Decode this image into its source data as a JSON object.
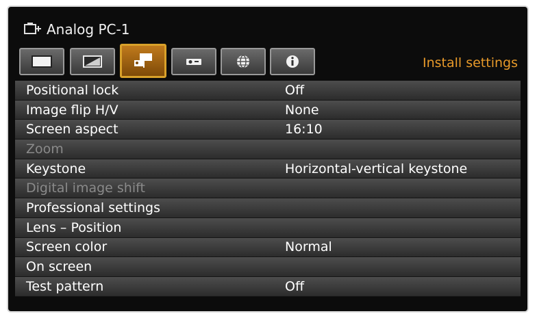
{
  "header": {
    "source_label": "Analog PC-1",
    "section_title": "Install settings"
  },
  "tabs": [
    {
      "icon": "image-icon"
    },
    {
      "icon": "image-adjust-icon"
    },
    {
      "icon": "install-settings-icon",
      "active": true
    },
    {
      "icon": "projector-icon"
    },
    {
      "icon": "network-icon"
    },
    {
      "icon": "information-icon"
    }
  ],
  "menu": {
    "items": [
      {
        "label": "Positional lock",
        "value": "Off",
        "enabled": true
      },
      {
        "label": "Image flip H/V",
        "value": "None",
        "enabled": true
      },
      {
        "label": "Screen aspect",
        "value": "16:10",
        "enabled": true
      },
      {
        "label": "Zoom",
        "value": "",
        "enabled": false
      },
      {
        "label": "Keystone",
        "value": "Horizontal-vertical keystone",
        "enabled": true
      },
      {
        "label": "Digital image shift",
        "value": "",
        "enabled": false
      },
      {
        "label": "Professional settings",
        "value": "",
        "enabled": true
      },
      {
        "label": "Lens – Position",
        "value": "",
        "enabled": true
      },
      {
        "label": "Screen color",
        "value": "Normal",
        "enabled": true
      },
      {
        "label": "On screen",
        "value": "",
        "enabled": true
      },
      {
        "label": "Test pattern",
        "value": "Off",
        "enabled": true
      }
    ]
  },
  "colors": {
    "accent": "#e89a2a",
    "active_tab": "#c07a1c",
    "row": "#3c3c3c",
    "disabled_text": "#8a8a8a"
  }
}
